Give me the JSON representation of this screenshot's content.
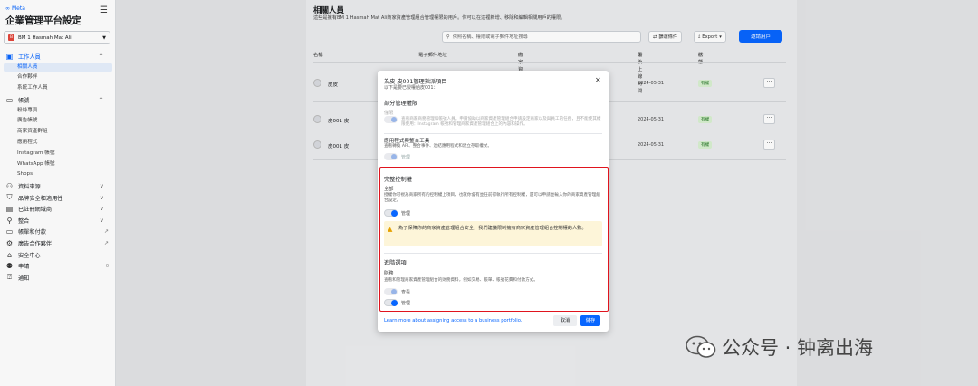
{
  "sidebar": {
    "brand": "Meta",
    "title": "企業管理平台設定",
    "account": {
      "avatar_letter": "B",
      "name": "BM 1 Hasmah Mat Ali"
    },
    "sections": [
      {
        "label": "工作人員",
        "icon": "users-icon",
        "active": true,
        "items": [
          "相關人員",
          "合作夥伴",
          "系統工作人員"
        ]
      },
      {
        "label": "帳號",
        "icon": "account-icon",
        "active": false,
        "items": [
          "粉絲專頁",
          "廣告帳號",
          "商家資產群組",
          "應用程式",
          "Instagram 帳號",
          "WhatsApp 帳號",
          "Shops"
        ]
      },
      {
        "label": "資料來源",
        "icon": "data-sources-icon"
      },
      {
        "label": "品牌安全和適用性",
        "icon": "shield-icon"
      },
      {
        "label": "已註冊網域商",
        "icon": "domain-icon"
      },
      {
        "label": "整合",
        "icon": "integrations-icon"
      },
      {
        "label": "帳單和付款",
        "icon": "billing-icon",
        "external": true
      },
      {
        "label": "廣告合作夥伴",
        "icon": "partners-icon",
        "external": true
      },
      {
        "label": "安全中心",
        "icon": "lock-icon"
      },
      {
        "label": "申請",
        "icon": "requests-icon",
        "count": "0"
      },
      {
        "label": "通知",
        "icon": "bell-icon"
      }
    ]
  },
  "page": {
    "title": "相關人員",
    "description": "這些是擁有BM 1 Hasmah Mat Ali商家資產管理組合管理權限的用戶。你可以在這裡新增、移除和編輯相關用戶的權限。",
    "search_placeholder": "依照名稱、權限或電子郵件地址搜尋",
    "filter_label": "篩選條件",
    "export_label": "Export",
    "invite_label": "邀請用戶",
    "columns": [
      "名稱",
      "電子郵件地址",
      "商家資產管理組合管理權限",
      "最後上線時間",
      "狀態"
    ],
    "rows": [
      {
        "name": "皮皮",
        "date": "2024-05-31",
        "status": "有權"
      },
      {
        "name": "皮001 皮",
        "date": "2024-05-31",
        "status": "有權"
      },
      {
        "name": "皮001 皮",
        "date": "2024-05-31",
        "status": "有權"
      }
    ]
  },
  "modal": {
    "title": "為皮 皮001管理指派項目",
    "subtitle": "以下是要已授權給皮001：",
    "partial": {
      "heading": "部分管理權限",
      "option": "僅限",
      "desc": "查看商家商務管理和帳號人員。申請協助以商家資產管理組合申請設定商家以及與員工的任務，且不能使其權限使用：Instagram 帳號和管理商家資產管理組合上的內容和操作。",
      "toggle": "管理"
    },
    "devtools": {
      "heading": "應用程式與整合工具",
      "desc": "查看轉換 API、整合事件、連結應用程式和建立存取權杖。",
      "toggle": "管理"
    },
    "full": {
      "heading": "完整控制權",
      "option": "全部",
      "desc": "授權你可視為商家所有的控制權上項目，也就你會有並任前得執行所有控制權，還可以申請並輸入你的商家資產管理組合設定。",
      "toggle": "管理",
      "warning": "為了保障你的商家資產管理組合安全，我們建議限制擁有商家資產管理組合控制權的人數。"
    },
    "advanced": {
      "heading": "進階選項",
      "option": "財務",
      "desc": "查看和管理商家資產管理組合的財務資料，例如交易、帳單、帳號花費和付款方式。",
      "toggle1": "查看",
      "toggle2": "管理"
    },
    "link": "Learn more about assigning access to a business portfolio.",
    "cancel": "取消",
    "save": "儲存"
  },
  "watermark": "公众号 · 钟离出海",
  "colors": {
    "accent": "#0866ff",
    "highlight": "#e0141e",
    "warning_bg": "#fdf5d9"
  }
}
